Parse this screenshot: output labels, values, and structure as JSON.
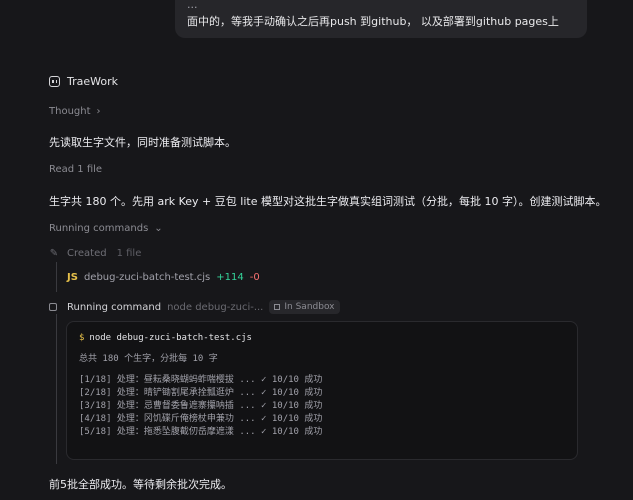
{
  "user_message": {
    "line1": "...",
    "line2": "面中的，等我手动确认之后再push 到github， 以及部署到github pages上"
  },
  "assistant": {
    "name": "TraeWork",
    "thought_label": "Thought",
    "text1": "先读取生字文件，同时准备测试脚本。",
    "read_label": "Read 1 file",
    "text2": "生字共 180 个。先用 ark Key + 豆包 lite 模型对这批生字做真实组词测试（分批，每批 10 字）。创建测试脚本。",
    "running_commands_label": "Running commands",
    "created": {
      "label": "Created",
      "count": "1 file"
    },
    "file": {
      "badge": "JS",
      "name": "debug-zuci-batch-test.cjs",
      "additions": "+114",
      "deletions": "-0"
    },
    "command": {
      "label": "Running command",
      "preview": "node debug-zuci-...",
      "sandbox_label": "In Sandbox"
    },
    "terminal": {
      "prompt": "$",
      "command": "node debug-zuci-batch-test.cjs",
      "summary": "总共 180 个生字，分批每 10 字",
      "lines": [
        "[1/18] 处理：昼耘桑晓蝴蚂蚱喘樱拔 ... ✓ 10/10 成功",
        "[2/18] 处理：晴铲锄割尾承拴瓢逛炉 ... ✓ 10/10 成功",
        "[3/18] 处理：忌曹督委鲁遮寨攥呐插 ... ✓ 10/10 成功",
        "[4/18] 处理：冈饥碟斤俺榜杖申兼功 ... ✓ 10/10 成功",
        "[5/18] 处理：拖悉坠腹截仞岳摩遮漾 ... ✓ 10/10 成功"
      ]
    },
    "text3": "前5批全部成功。等待剩余批次完成。"
  }
}
